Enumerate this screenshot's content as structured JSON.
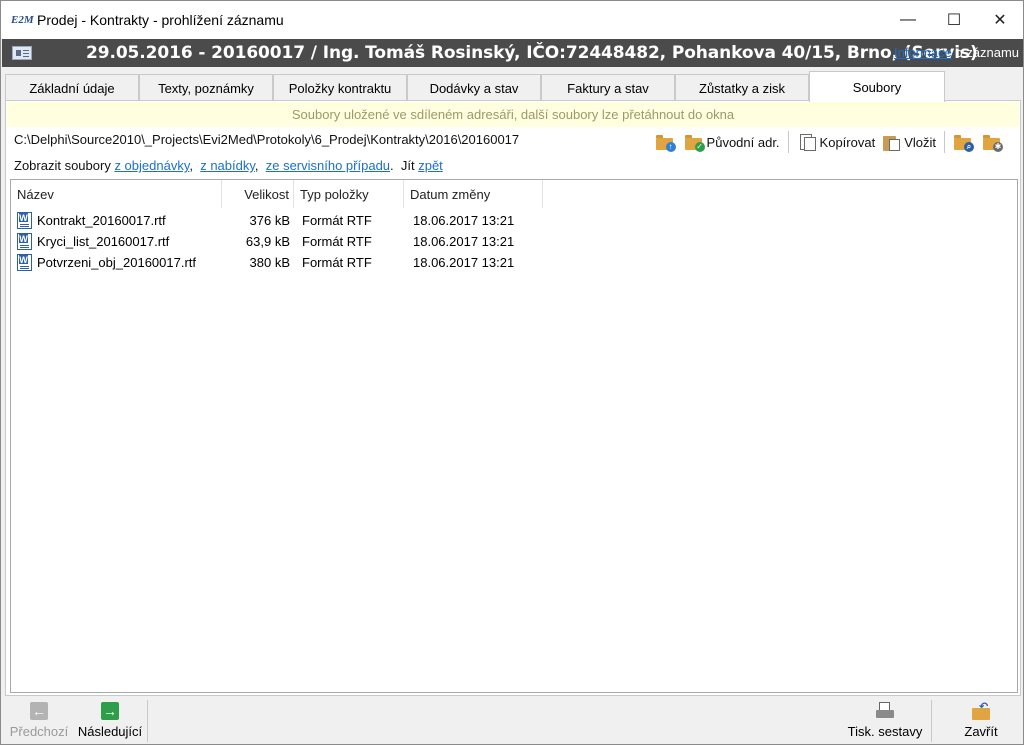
{
  "window": {
    "title": "Prodej - Kontrakty - prohlížení záznamu",
    "app_icon": "E2M",
    "controls": {
      "minimize": "—",
      "maximize": "☐",
      "close": "✕"
    }
  },
  "banner": {
    "title": "29.05.2016 - 20160017 / Ing. Tomáš Rosinský, IČO:72448482, Pohankova 40/15, Brno, (Servis)",
    "info_link": "Informace",
    "info_suffix": " o záznamu"
  },
  "tabs": [
    {
      "label": "Základní údaje",
      "active": false
    },
    {
      "label": "Texty, poznámky",
      "active": false
    },
    {
      "label": "Položky kontraktu",
      "active": false
    },
    {
      "label": "Dodávky a stav",
      "active": false
    },
    {
      "label": "Faktury a stav",
      "active": false
    },
    {
      "label": "Zůstatky a zisk",
      "active": false
    },
    {
      "label": "Soubory",
      "active": true
    }
  ],
  "files_tab": {
    "hint": "Soubory uložené ve sdíleném adresáři, další soubory lze přetáhnout do okna",
    "path": "C:\\Delphi\\Source2010\\_Projects\\Evi2Med\\Protokoly\\6_Prodej\\Kontrakty\\2016\\20160017",
    "toolbar": {
      "original_dir_label": "Původní adr.",
      "copy_label": "Kopírovat",
      "paste_label": "Vložit"
    },
    "links": {
      "prefix": "Zobrazit soubory ",
      "from_order": "z objednávky",
      "from_offer": "z nabídky",
      "from_service": "ze servisního případu",
      "go_label": "Jít ",
      "back": "zpět"
    },
    "columns": {
      "name": "Název",
      "size": "Velikost",
      "type": "Typ položky",
      "date": "Datum změny"
    },
    "rows": [
      {
        "name": "Kontrakt_20160017.rtf",
        "size": "376 kB",
        "type": "Formát RTF",
        "date": "18.06.2017 13:21"
      },
      {
        "name": "Kryci_list_20160017.rtf",
        "size": "63,9 kB",
        "type": "Formát RTF",
        "date": "18.06.2017 13:21"
      },
      {
        "name": "Potvrzeni_obj_20160017.rtf",
        "size": "380 kB",
        "type": "Formát RTF",
        "date": "18.06.2017 13:21"
      }
    ]
  },
  "bottombar": {
    "prev_label": "Předchozí",
    "next_label": "Následující",
    "print_label": "Tisk. sestavy",
    "close_label": "Zavřít"
  },
  "colors": {
    "banner_bg": "#4b4b4b",
    "hint_bg": "#ffffe0",
    "link": "#1a6fd1",
    "next_green": "#2e9e4a",
    "prev_gray": "#a8a8a8"
  }
}
